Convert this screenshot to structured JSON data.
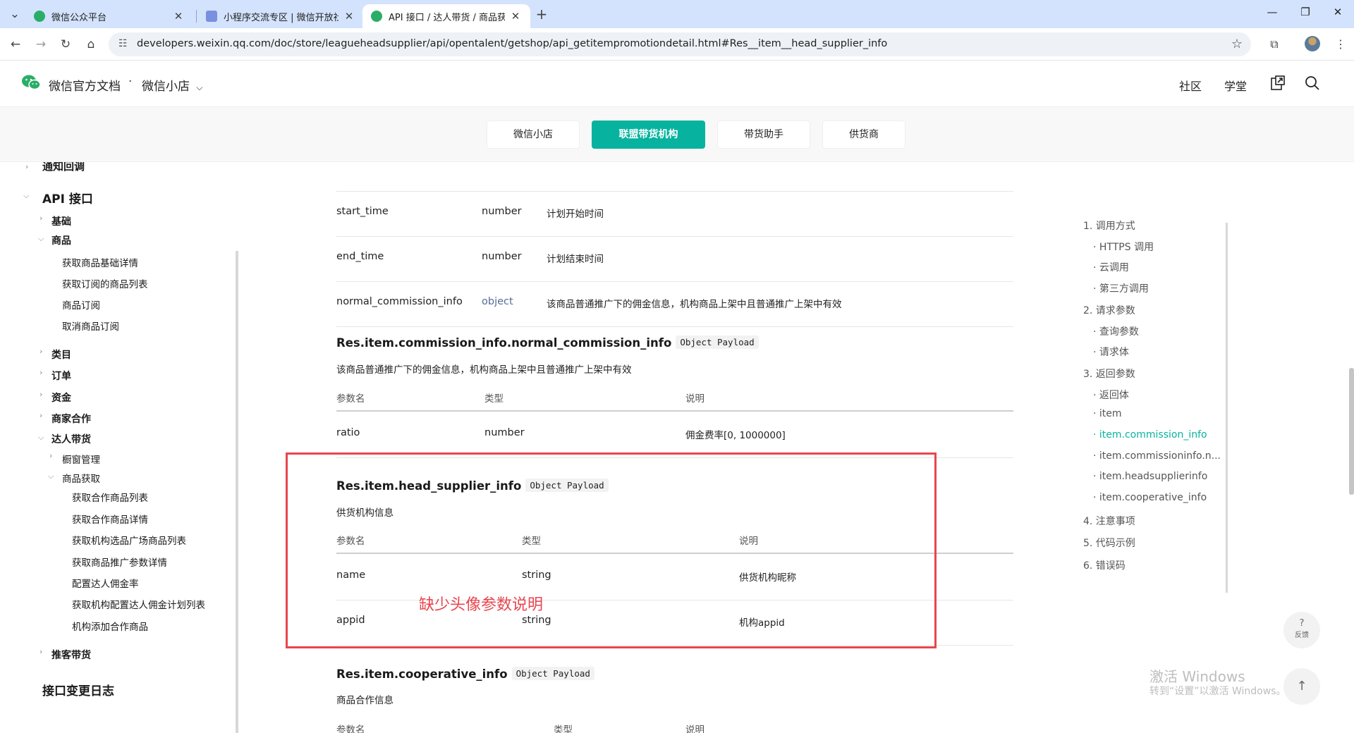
{
  "browser": {
    "tabs": [
      {
        "title": "微信公众平台",
        "fav_color": "#2aae67",
        "active": false
      },
      {
        "title": "小程序交流专区 | 微信开放社区",
        "fav_color": "#7b8fe0",
        "active": false
      },
      {
        "title": "API 接口 / 达人带货 / 商品获取",
        "fav_color": "#2aae67",
        "active": true
      }
    ],
    "new_tab": "+",
    "url": "developers.weixin.qq.com/doc/store/leagueheadsupplier/api/opentalent/getshop/api_getitempromotiondetail.html#Res__item__head_supplier_info"
  },
  "header": {
    "brand": "微信官方文档",
    "dot": "·",
    "product": "微信小店",
    "links": [
      "社区",
      "学堂"
    ]
  },
  "subnav": {
    "items": [
      "微信小店",
      "联盟带货机构",
      "带货助手",
      "供货商"
    ],
    "active_index": 1,
    "accent": "#07b39e"
  },
  "sidebar": {
    "cut_top": "通知回调",
    "api": "API 接口",
    "basic": "基础",
    "goods": "商品",
    "goods_items": [
      "获取商品基础详情",
      "获取订阅的商品列表",
      "商品订阅",
      "取消商品订阅"
    ],
    "category": "类目",
    "order": "订单",
    "fund": "资金",
    "merchant": "商家合作",
    "talent": "达人带货",
    "window": "橱窗管理",
    "getgoods": "商品获取",
    "getgoods_items": [
      "获取合作商品列表",
      "获取合作商品详情",
      "获取机构选品广场商品列表",
      "获取商品推广参数详情",
      "配置达人佣金率",
      "获取机构配置达人佣金计划列表",
      "机构添加合作商品"
    ],
    "recommend": "推客带货",
    "changelog": "接口变更日志"
  },
  "content": {
    "rows_top": [
      {
        "name": "start_time",
        "type": "number",
        "desc": "计划开始时间",
        "link": false
      },
      {
        "name": "end_time",
        "type": "number",
        "desc": "计划结束时间",
        "link": false
      },
      {
        "name": "normal_commission_info",
        "type": "object",
        "desc": "该商品普通推广下的佣金信息，机构商品上架中且普通推广上架中有效",
        "link": true
      }
    ],
    "tag": "Object Payload",
    "headers": [
      "参数名",
      "类型",
      "说明"
    ],
    "sec1": {
      "title": "Res.item.commission_info.normal_commission_info",
      "desc": "该商品普通推广下的佣金信息，机构商品上架中且普通推广上架中有效",
      "rows": [
        {
          "name": "ratio",
          "type": "number",
          "desc": "佣金费率[0, 1000000]"
        }
      ]
    },
    "sec2": {
      "title": "Res.item.head_supplier_info",
      "desc": "供货机构信息",
      "rows": [
        {
          "name": "name",
          "type": "string",
          "desc": "供货机构昵称"
        },
        {
          "name": "appid",
          "type": "string",
          "desc": "机构appid"
        }
      ]
    },
    "sec3": {
      "title": "Res.item.cooperative_info",
      "desc": "商品合作信息"
    },
    "annotation": "缺少头像参数说明",
    "annotation_color": "#e8454f"
  },
  "toc": {
    "items": [
      "1. 调用方式",
      "· HTTPS 调用",
      "· 云调用",
      "· 第三方调用",
      "2. 请求参数",
      "· 查询参数",
      "· 请求体",
      "3. 返回参数",
      "· 返回体",
      "· item",
      "· item.commission_info",
      "· item.commissioninfo.n...",
      "· item.headsupplierinfo",
      "· item.cooperative_info",
      "4. 注意事项",
      "5. 代码示例",
      "6. 错误码"
    ],
    "active_index": 10
  },
  "watermark": {
    "line1": "激活 Windows",
    "line2": "转到“设置”以激活 Windows。"
  },
  "fab": {
    "help_q": "?",
    "help_label": "反馈",
    "top_arrow": "↑"
  }
}
